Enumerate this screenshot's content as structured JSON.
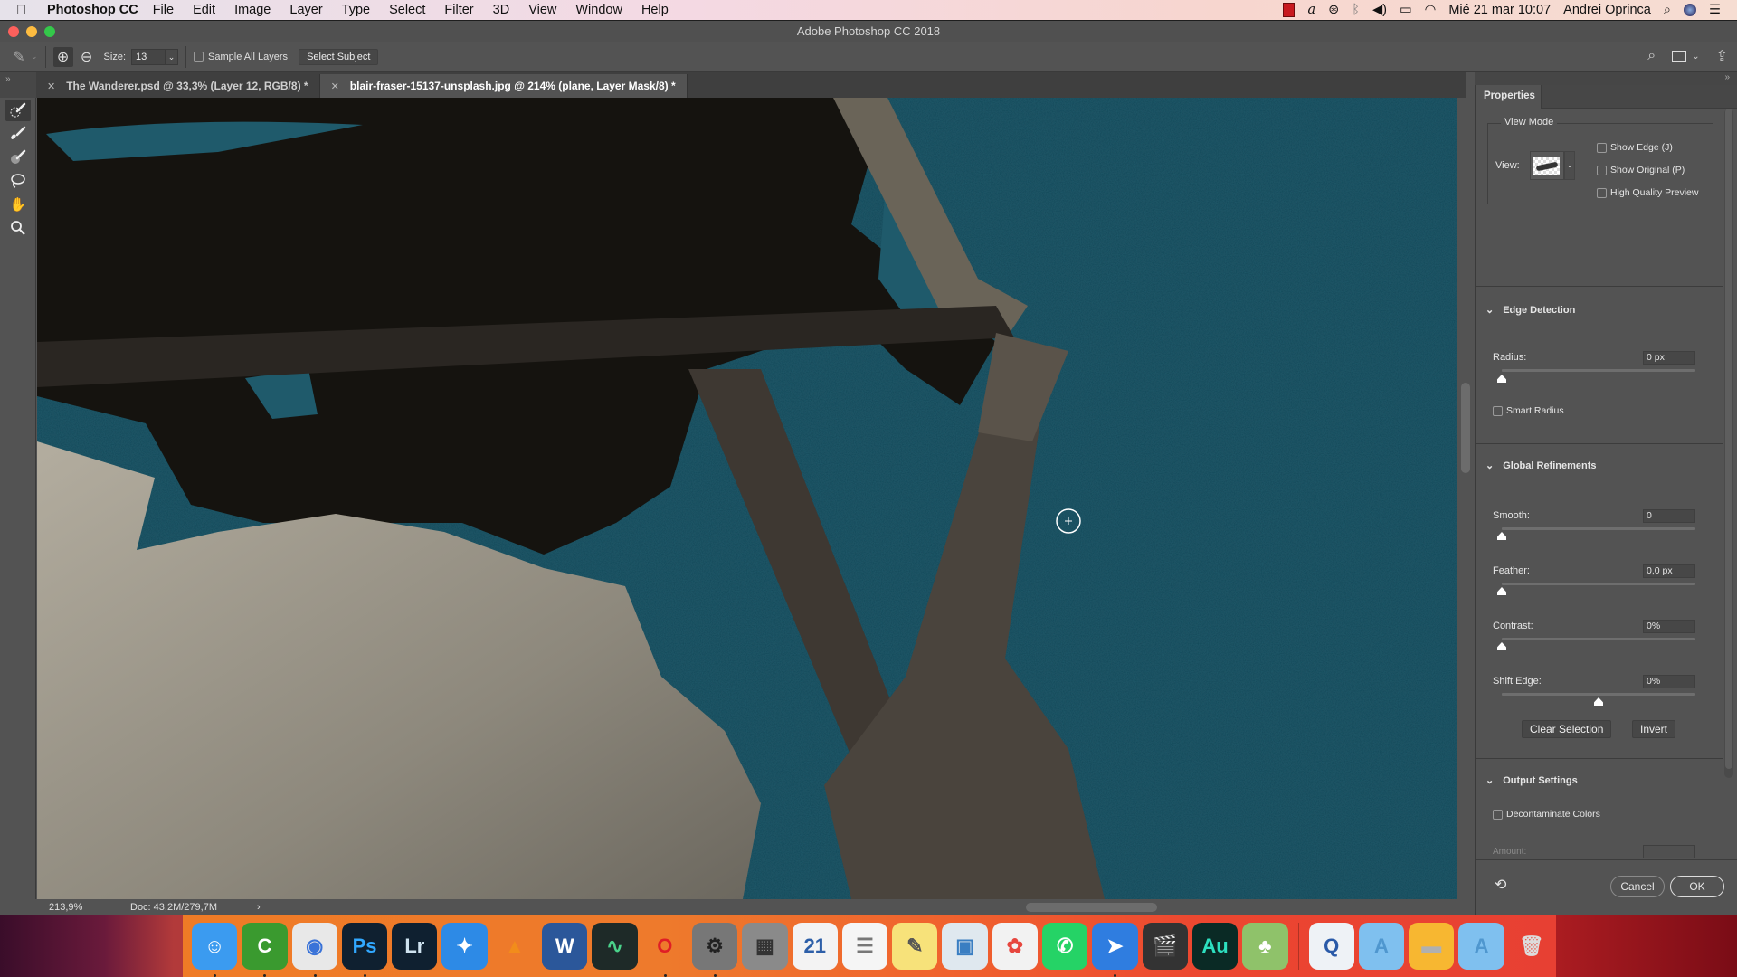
{
  "menubar": {
    "app_name": "Photoshop CC",
    "menus": [
      "File",
      "Edit",
      "Image",
      "Layer",
      "Type",
      "Select",
      "Filter",
      "3D",
      "View",
      "Window",
      "Help"
    ],
    "clock": "Mié 21 mar  10:07",
    "user": "Andrei Oprinca",
    "status_icons": [
      "screen-recorder-icon",
      "signature-icon",
      "creative-cloud-icon",
      "bluetooth-icon",
      "volume-icon",
      "airplay-icon",
      "wifi-icon"
    ]
  },
  "window": {
    "title": "Adobe Photoshop CC 2018"
  },
  "options_bar": {
    "size_label": "Size:",
    "size_value": "13",
    "sample_all_layers_label": "Sample All Layers",
    "sample_all_layers_checked": false,
    "select_subject_label": "Select Subject"
  },
  "tabs": [
    {
      "label": "The Wanderer.psd @ 33,3% (Layer 12, RGB/8) *",
      "active": false
    },
    {
      "label": "blair-fraser-15137-unsplash.jpg @ 214% (plane, Layer Mask/8) *",
      "active": true
    }
  ],
  "tools": [
    "quick-selection-brush",
    "refine-edge-brush",
    "brush",
    "lasso",
    "hand",
    "zoom"
  ],
  "status_bar": {
    "zoom": "213,9%",
    "doc": "Doc: 43,2M/279,7M",
    "arrow": "›"
  },
  "properties": {
    "tab_label": "Properties",
    "view_mode": {
      "title": "View Mode",
      "view_label": "View:",
      "show_edge": {
        "label": "Show Edge (J)",
        "checked": false
      },
      "show_original": {
        "label": "Show Original (P)",
        "checked": false
      },
      "high_quality": {
        "label": "High Quality Preview",
        "checked": false
      }
    },
    "edge_detection": {
      "title": "Edge Detection",
      "radius_label": "Radius:",
      "radius_value": "0 px",
      "radius_fraction": 0,
      "smart_radius": {
        "label": "Smart Radius",
        "checked": false
      }
    },
    "global_refinements": {
      "title": "Global Refinements",
      "smooth_label": "Smooth:",
      "smooth_value": "0",
      "smooth_fraction": 0,
      "feather_label": "Feather:",
      "feather_value": "0,0 px",
      "feather_fraction": 0,
      "contrast_label": "Contrast:",
      "contrast_value": "0%",
      "contrast_fraction": 0,
      "shift_edge_label": "Shift Edge:",
      "shift_edge_value": "0%",
      "shift_edge_fraction": 0.5,
      "clear_selection_label": "Clear Selection",
      "invert_label": "Invert"
    },
    "output_settings": {
      "title": "Output Settings",
      "decontaminate": {
        "label": "Decontaminate Colors",
        "checked": false
      },
      "amount_label": "Amount:"
    },
    "cancel_label": "Cancel",
    "ok_label": "OK"
  },
  "dock": {
    "apps": [
      {
        "name": "Finder",
        "glyph": "☺",
        "bg": "#3b9bf0",
        "fg": "#fff",
        "running": true
      },
      {
        "name": "Camtasia",
        "glyph": "C",
        "bg": "#3a9a2f",
        "fg": "#fff",
        "running": true
      },
      {
        "name": "Chrome",
        "glyph": "◉",
        "bg": "#e8e8e8",
        "fg": "#3a73d8",
        "running": true
      },
      {
        "name": "Photoshop",
        "glyph": "Ps",
        "bg": "#0f2030",
        "fg": "#31a8ff",
        "running": true
      },
      {
        "name": "Lightroom",
        "glyph": "Lr",
        "bg": "#0f2030",
        "fg": "#cfe3f0",
        "running": false
      },
      {
        "name": "Safari",
        "glyph": "✦",
        "bg": "#2d8ae6",
        "fg": "#fff",
        "running": false
      },
      {
        "name": "VLC",
        "glyph": "▲",
        "bg": "transparent",
        "fg": "#f28c1b",
        "running": false
      },
      {
        "name": "Word",
        "glyph": "W",
        "bg": "#2b579a",
        "fg": "#fff",
        "running": false
      },
      {
        "name": "Activity Monitor",
        "glyph": "∿",
        "bg": "#1e2a28",
        "fg": "#4ad28a",
        "running": false
      },
      {
        "name": "Opera",
        "glyph": "O",
        "bg": "transparent",
        "fg": "#e01e25",
        "running": true
      },
      {
        "name": "System Preferences",
        "glyph": "⚙",
        "bg": "#777",
        "fg": "#222",
        "running": true
      },
      {
        "name": "Calculator",
        "glyph": "▦",
        "bg": "#8a8a8a",
        "fg": "#333",
        "running": false
      },
      {
        "name": "Calendar",
        "glyph": "21",
        "bg": "#f3f3f3",
        "fg": "#2d5fa8",
        "running": false
      },
      {
        "name": "Reminders",
        "glyph": "☰",
        "bg": "#f5f5f5",
        "fg": "#777",
        "running": false
      },
      {
        "name": "Notes",
        "glyph": "✎",
        "bg": "#f7e27a",
        "fg": "#555",
        "running": false
      },
      {
        "name": "Preview",
        "glyph": "▣",
        "bg": "#dfe8ef",
        "fg": "#3a7ec2",
        "running": false
      },
      {
        "name": "Photos",
        "glyph": "✿",
        "bg": "#f2f2f2",
        "fg": "#e7463e",
        "running": false
      },
      {
        "name": "WhatsApp",
        "glyph": "✆",
        "bg": "#25d366",
        "fg": "#fff",
        "running": false
      },
      {
        "name": "Spark",
        "glyph": "➤",
        "bg": "#2f7de0",
        "fg": "#fff",
        "running": true
      },
      {
        "name": "Final Cut Pro",
        "glyph": "🎬",
        "bg": "#333",
        "fg": "#fff",
        "running": false
      },
      {
        "name": "Audition",
        "glyph": "Au",
        "bg": "#0a2a25",
        "fg": "#2de0c0",
        "running": false
      },
      {
        "name": "MacFamilyTree",
        "glyph": "♣",
        "bg": "#8fc26a",
        "fg": "#fff",
        "running": false
      }
    ],
    "others": [
      {
        "name": "AVI File",
        "glyph": "Q",
        "bg": "#eef2f6",
        "fg": "#2a5aa8"
      },
      {
        "name": "Applications Folder",
        "glyph": "A",
        "bg": "#7fc0ef",
        "fg": "#4f97cf"
      },
      {
        "name": "External Drive",
        "glyph": "▬",
        "bg": "#f7b731",
        "fg": "#b0b0b0"
      },
      {
        "name": "Downloads Folder",
        "glyph": "A",
        "bg": "#7fc0ef",
        "fg": "#4f97cf"
      },
      {
        "name": "Trash",
        "glyph": "🗑",
        "bg": "transparent",
        "fg": "#ddd"
      }
    ]
  }
}
